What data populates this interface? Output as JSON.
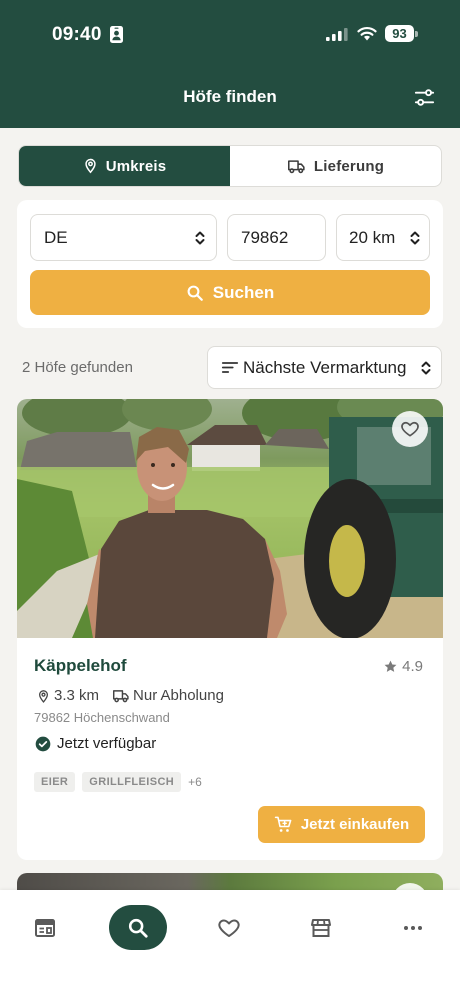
{
  "status_bar": {
    "time": "09:40",
    "battery": "93",
    "icons": [
      "contact-card-icon",
      "signal-icon",
      "wifi-icon",
      "battery-icon"
    ]
  },
  "header": {
    "title": "Höfe finden",
    "action_icon": "filter-sliders-icon"
  },
  "mode_tabs": [
    {
      "label": "Umkreis",
      "icon": "location-pin-icon",
      "selected": true
    },
    {
      "label": "Lieferung",
      "icon": "truck-icon",
      "selected": false
    }
  ],
  "search": {
    "country": "DE",
    "postcode": "79862",
    "radius": "20 km",
    "submit_label": "Suchen",
    "submit_icon": "search-icon"
  },
  "results": {
    "count_label": "2 Höfe gefunden",
    "sort_label": "Nächste Vermarktung",
    "sort_icon": "sort-lines-icon"
  },
  "farms": [
    {
      "name": "Käppelehof",
      "rating": "4.9",
      "distance": "3.3 km",
      "fulfillment": "Nur Abholung",
      "address": "79862 Höchenschwand",
      "availability": "Jetzt verfügbar",
      "tags": [
        "EIER",
        "GRILLFLEISCH"
      ],
      "more_tags": "+6",
      "cta_label": "Jetzt einkaufen",
      "favorite": false
    }
  ],
  "bottom_nav": [
    {
      "icon": "newspaper-icon",
      "active": false
    },
    {
      "icon": "search-icon",
      "active": true
    },
    {
      "icon": "heart-icon",
      "active": false
    },
    {
      "icon": "store-icon",
      "active": false
    },
    {
      "icon": "more-icon",
      "active": false
    }
  ],
  "colors": {
    "brand_green": "#234d40",
    "accent_orange": "#efb042",
    "page_background": "#f4f3f0",
    "tag_background": "#efefed"
  }
}
